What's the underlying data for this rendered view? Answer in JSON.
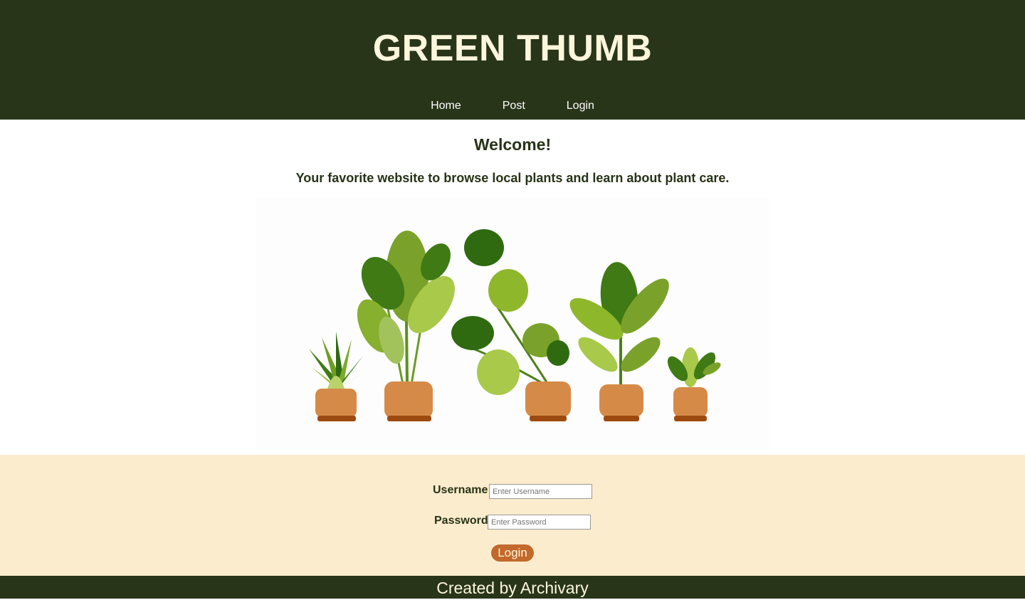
{
  "header": {
    "title": "GREEN THUMB",
    "nav": [
      "Home",
      "Post",
      "Login"
    ]
  },
  "main": {
    "welcome": "Welcome!",
    "tagline": "Your favorite website to browse local plants and learn about plant care."
  },
  "login": {
    "username_label": "Username",
    "username_placeholder": "Enter Username",
    "password_label": "Password",
    "password_placeholder": "Enter Password",
    "submit_label": "Login"
  },
  "footer": {
    "text": "Created by Archivary"
  },
  "colors": {
    "header_bg": "#293519",
    "title_text": "#fdf6dc",
    "login_bg": "#faeccc",
    "button_bg": "#c2692b",
    "pot": "#d68a47"
  }
}
